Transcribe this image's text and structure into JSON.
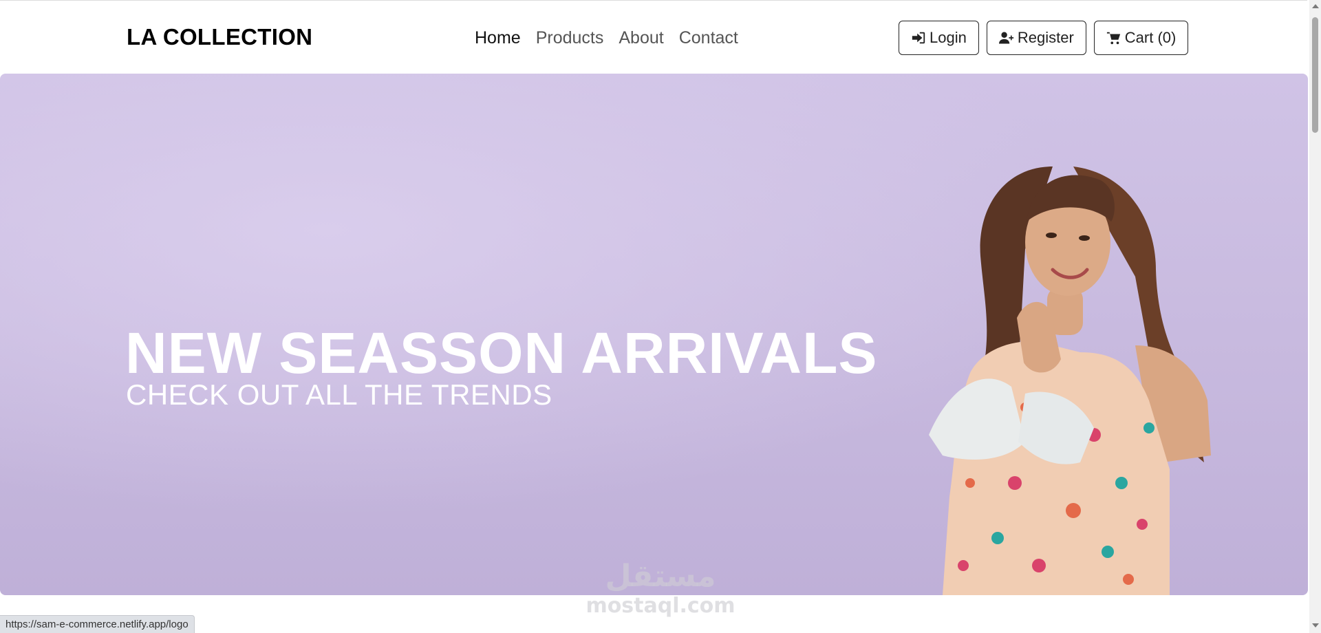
{
  "navbar": {
    "brand": "LA COLLECTION",
    "links": [
      {
        "label": "Home",
        "active": true
      },
      {
        "label": "Products",
        "active": false
      },
      {
        "label": "About",
        "active": false
      },
      {
        "label": "Contact",
        "active": false
      }
    ],
    "actions": {
      "login_label": "Login",
      "register_label": "Register",
      "cart_label": "Cart (0)"
    },
    "icons": {
      "login": "sign-in-icon",
      "register": "user-plus-icon",
      "cart": "shopping-cart-icon"
    }
  },
  "hero": {
    "title": "NEW SEASSON ARRIVALS",
    "subtitle": "CHECK OUT ALL THE TRENDS",
    "background_color": "#cbbde2"
  },
  "watermark": {
    "logo_text": "مستقل",
    "domain": "mostaql.com"
  },
  "status_bar": {
    "hover_url": "https://sam-e-commerce.netlify.app/logo"
  }
}
